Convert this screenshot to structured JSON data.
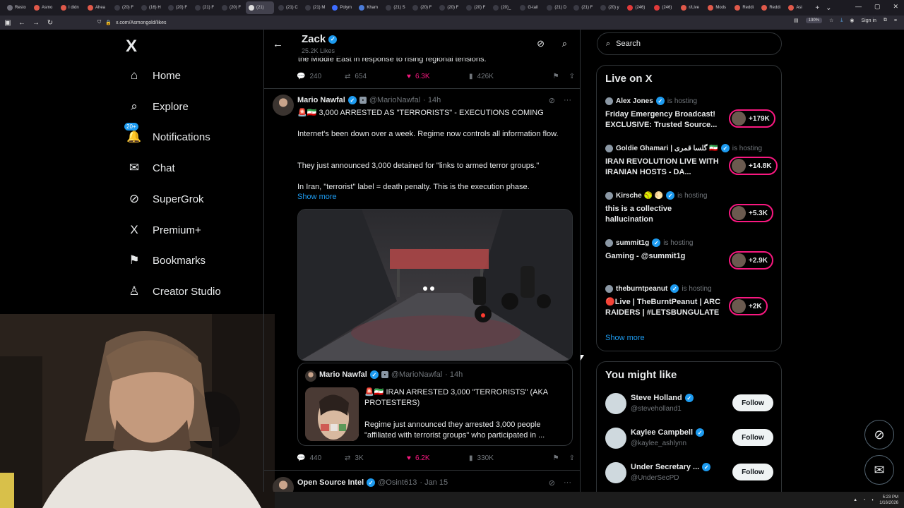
{
  "browser": {
    "tabs": [
      "Resto",
      "Asmo",
      "I didn",
      "Ahea",
      "(20) F",
      "(16) H",
      "(20) F",
      "(21) F",
      "(20) F",
      "(21)",
      "(21) C",
      "(21) M",
      "Polym",
      "Kham",
      "(21) S",
      "(20) F",
      "(20) F",
      "(20) F",
      "(20)_",
      "G-tail",
      "(21) D",
      "(21) F",
      "(20) y",
      "(246)",
      "(246)",
      "r/Live",
      "Mods",
      "Reddi",
      "Reddi",
      "Asi"
    ],
    "active_tab_index": 9,
    "url": "x.com/Asmongold/likes",
    "zoom": "130%",
    "signin": "Sign in"
  },
  "nav": {
    "logo": "X",
    "items": [
      {
        "label": "Home",
        "icon": "home-icon",
        "glyph": "⌂"
      },
      {
        "label": "Explore",
        "icon": "search-icon",
        "glyph": "⌕"
      },
      {
        "label": "Notifications",
        "icon": "bell-icon",
        "glyph": "🔔",
        "badge": "20+"
      },
      {
        "label": "Chat",
        "icon": "mail-icon",
        "glyph": "✉"
      },
      {
        "label": "SuperGrok",
        "icon": "grok-icon",
        "glyph": "⊘"
      },
      {
        "label": "Premium+",
        "icon": "x-icon",
        "glyph": "X"
      },
      {
        "label": "Bookmarks",
        "icon": "bookmark-icon",
        "glyph": "⚑"
      },
      {
        "label": "Creator Studio",
        "icon": "creator-icon",
        "glyph": "♙"
      }
    ]
  },
  "header": {
    "name": "Zack",
    "likes": "25.2K Likes"
  },
  "prev_post": {
    "text": "the Middle East in response to rising regional tensions.",
    "replies": "240",
    "reposts": "654",
    "likes": "6.3K",
    "views": "426K"
  },
  "post": {
    "name": "Mario Nawfal",
    "handle": "@MarioNawfal",
    "time": "· 14h",
    "headline": "🚨🇮🇷 3,000 ARRESTED AS \"TERRORISTS\" - EXECUTIONS COMING",
    "p1": "Internet's been down over a week. Regime now controls all information flow.",
    "p2": "They just announced 3,000 detained for \"links to armed terror groups.\"",
    "p3": "In Iran, \"terrorist\" label = death penalty. This is the execution phase.",
    "show_more": "Show more",
    "quote": {
      "name": "Mario Nawfal",
      "handle": "@MarioNawfal",
      "time": "· 14h",
      "headline": "🚨🇮🇷 IRAN ARRESTED 3,000 \"TERRORISTS\" (AKA PROTESTERS)",
      "body": "Regime just announced they arrested 3,000 people \"affiliated with terrorist groups\" who participated in ..."
    },
    "replies": "440",
    "reposts": "3K",
    "likes": "6.2K",
    "views": "330K"
  },
  "next_post": {
    "name": "Open Source Intel",
    "handle": "@Osint613",
    "time": "· Jan 15"
  },
  "search": {
    "placeholder": "Search"
  },
  "live": {
    "title": "Live on X",
    "is_hosting": "is hosting",
    "items": [
      {
        "host": "Alex Jones",
        "title": "Friday Emergency Broadcast! EXCLUSIVE: Trusted Source...",
        "count": "+179K"
      },
      {
        "host": "Goldie Ghamari | گلسا قمری 🇮🇷",
        "title": "IRAN REVOLUTION LIVE WITH IRANIAN HOSTS - DA...",
        "count": "+14.8K"
      },
      {
        "host": "Kirsche 🥎 🌕",
        "title": "this is a collective hallucination",
        "count": "+5.3K"
      },
      {
        "host": "summit1g",
        "title": "Gaming - @summit1g",
        "count": "+2.9K"
      },
      {
        "host": "theburntpeanut",
        "title": "🔴Live | TheBurntPeanut | ARC RAIDERS | #LETSBUNGULATE",
        "count": "+2K"
      }
    ],
    "show_more": "Show more"
  },
  "suggest": {
    "title": "You might like",
    "follow_label": "Follow",
    "items": [
      {
        "name": "Steve Holland",
        "handle": "@steveholland1"
      },
      {
        "name": "Kaylee Campbell",
        "handle": "@kaylee_ashlynn"
      },
      {
        "name": "Under Secretary ...",
        "handle": "@UnderSecPD"
      }
    ]
  },
  "taskbar": {
    "time": "5:23 PM",
    "date": "1/16/2026"
  }
}
